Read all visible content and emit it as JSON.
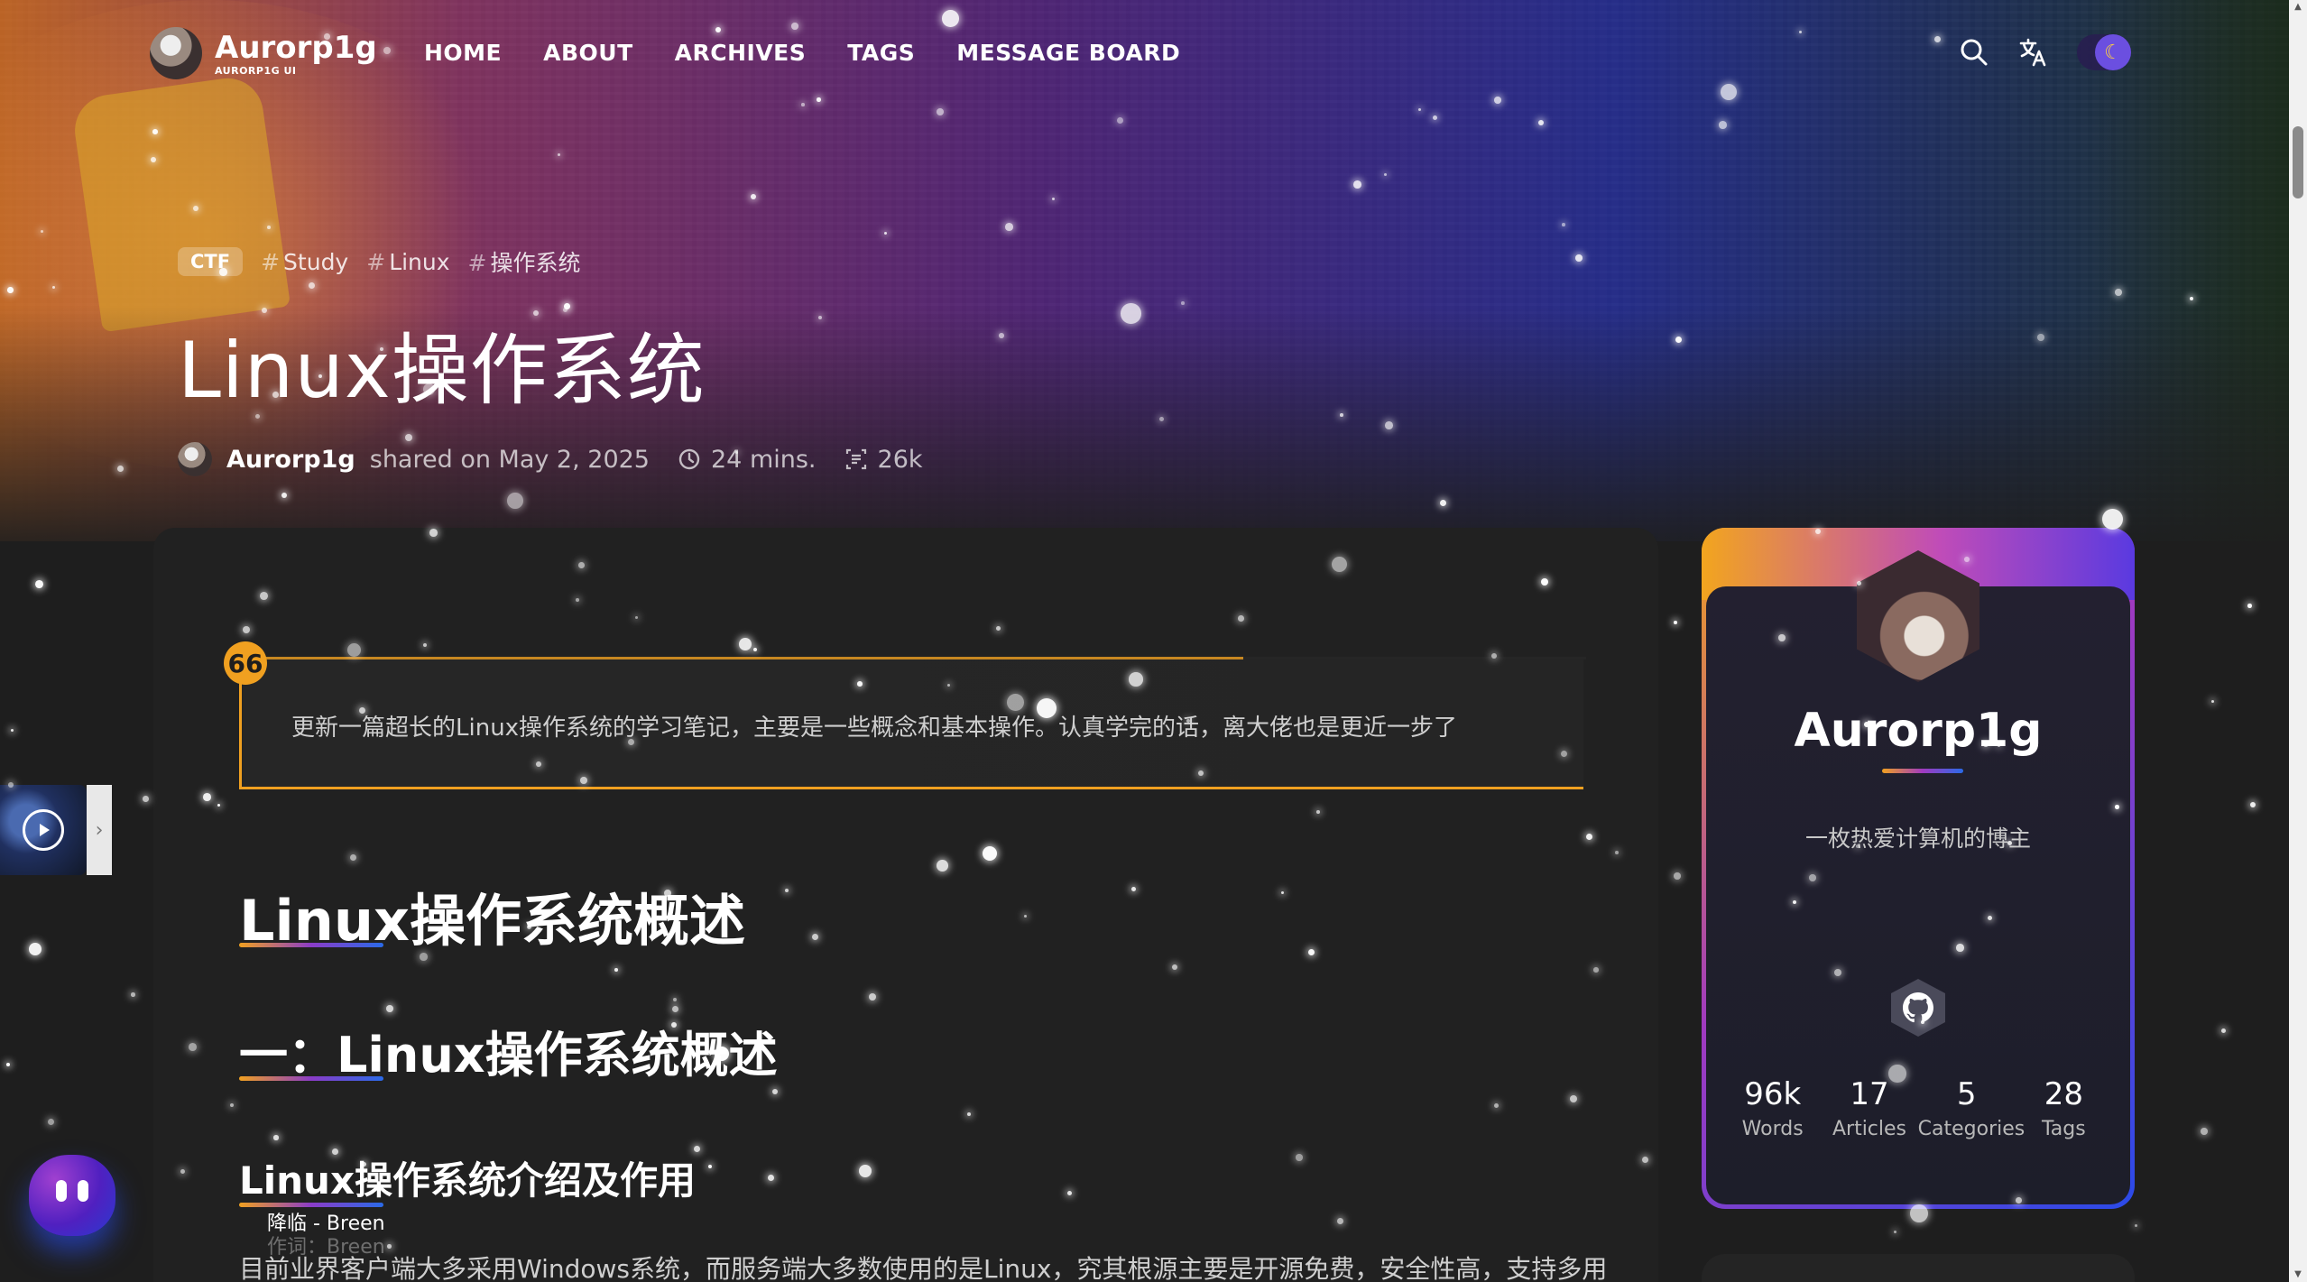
{
  "brand": {
    "name": "Aurorp1g",
    "subtitle": "AURORP1G UI"
  },
  "nav": {
    "items": [
      "HOME",
      "ABOUT",
      "ARCHIVES",
      "TAGS",
      "MESSAGE BOARD"
    ],
    "icons": [
      "search-icon",
      "translate-icon",
      "moon-icon"
    ],
    "toggle_glyph": "☾"
  },
  "post": {
    "category": "CTF",
    "tags": [
      "Study",
      "Linux",
      "操作系统"
    ],
    "title": "Linux操作系统",
    "author": "Aurorp1g",
    "shared_text": "shared on May 2, 2025",
    "read_time": "24 mins.",
    "word_count": "26k"
  },
  "article": {
    "quote_icon": "66",
    "quote": "更新一篇超长的Linux操作系统的学习笔记，主要是一些概念和基本操作。认真学完的话，离大佬也是更近一步了",
    "h1": "Linux操作系统概述",
    "h2": "一：Linux操作系统概述",
    "h3": "Linux操作系统介绍及作用",
    "paragraph": "目前业界客户端大多采用Windows系统，而服务端大多数使用的是Linux，究其根源主要是开源免费，安全性高，支持多用"
  },
  "profile": {
    "name": "Aurorp1g",
    "bio": "一枚热爱计算机的博主",
    "stats": [
      {
        "value": "96k",
        "label": "Words"
      },
      {
        "value": "17",
        "label": "Articles"
      },
      {
        "value": "5",
        "label": "Categories"
      },
      {
        "value": "28",
        "label": "Tags"
      }
    ]
  },
  "player": {
    "lyric_current": "降临 - Breen",
    "lyric_next": "作词：Breen",
    "arrow": "›"
  },
  "colors": {
    "accent_orange": "#f0a020",
    "accent_purple": "#a03ac0",
    "accent_blue": "#2a6ae8",
    "card_bg": "#212121",
    "page_bg": "#1e1e1e"
  }
}
